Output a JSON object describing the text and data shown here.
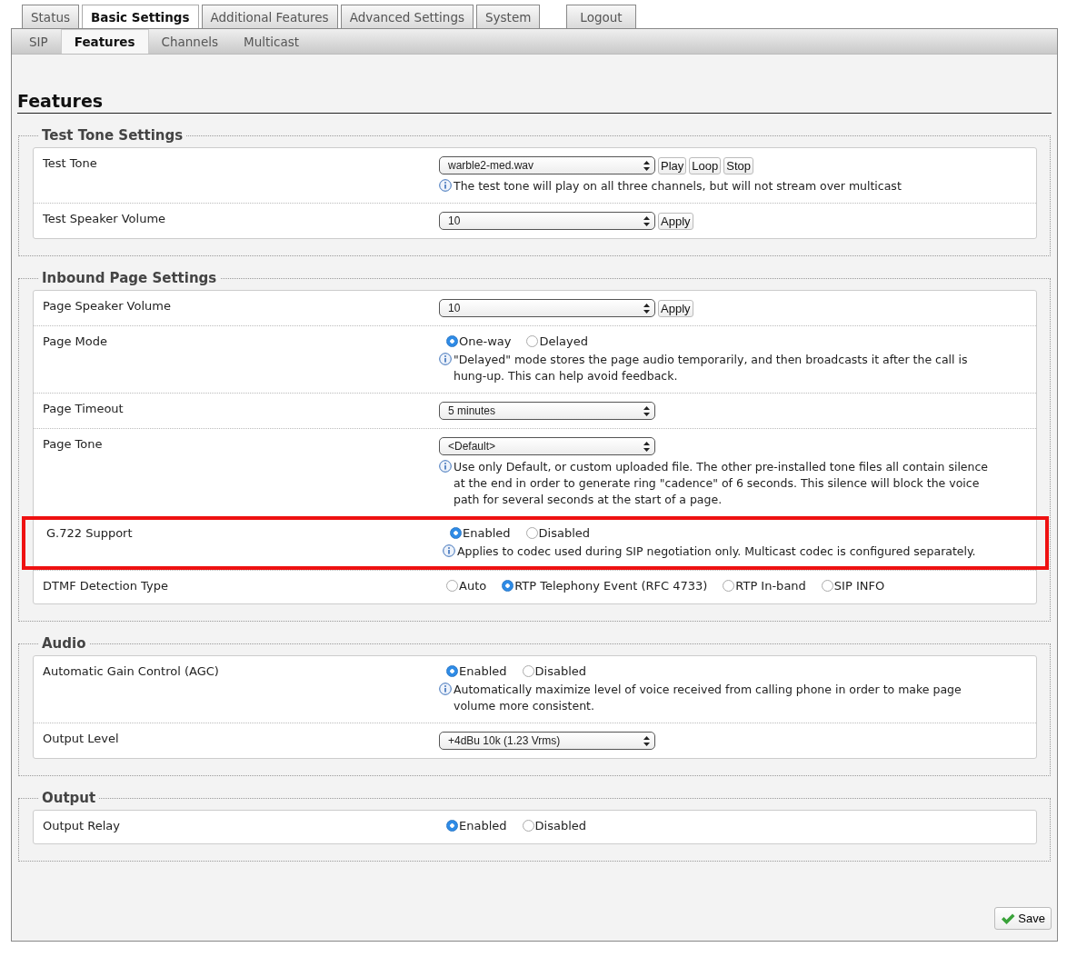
{
  "tabs": [
    {
      "label": "Status",
      "selected": false
    },
    {
      "label": "Basic Settings",
      "selected": true
    },
    {
      "label": "Additional Features",
      "selected": false
    },
    {
      "label": "Advanced Settings",
      "selected": false
    },
    {
      "label": "System",
      "selected": false
    },
    {
      "label": "Logout",
      "selected": false
    }
  ],
  "subtabs": [
    {
      "label": "SIP",
      "selected": false
    },
    {
      "label": "Features",
      "selected": true
    },
    {
      "label": "Channels",
      "selected": false
    },
    {
      "label": "Multicast",
      "selected": false
    }
  ],
  "page_title": "Features",
  "sections": [
    {
      "title": "Test Tone Settings",
      "rows": [
        {
          "label": "Test Tone",
          "highlighted": false,
          "control": {
            "kind": "select",
            "value": "warble2-med.wav",
            "buttons": [
              "Play",
              "Loop",
              "Stop"
            ]
          },
          "note": "The test tone will play on all three channels, but will not stream over multicast"
        },
        {
          "label": "Test Speaker Volume",
          "highlighted": false,
          "control": {
            "kind": "select",
            "value": "10",
            "buttons": [
              "Apply"
            ]
          }
        }
      ]
    },
    {
      "title": "Inbound Page Settings",
      "rows": [
        {
          "label": "Page Speaker Volume",
          "highlighted": false,
          "control": {
            "kind": "select",
            "value": "10",
            "buttons": [
              "Apply"
            ]
          }
        },
        {
          "label": "Page Mode",
          "highlighted": false,
          "control": {
            "kind": "radio",
            "options": [
              {
                "label": "One-way",
                "selected": true
              },
              {
                "label": "Delayed",
                "selected": false
              }
            ]
          },
          "note": "\"Delayed\" mode stores the page audio temporarily, and then broadcasts it after the call is hung-up. This can help avoid feedback."
        },
        {
          "label": "Page Timeout",
          "highlighted": false,
          "control": {
            "kind": "select",
            "value": "5 minutes"
          }
        },
        {
          "label": "Page Tone",
          "highlighted": false,
          "control": {
            "kind": "select",
            "value": "<Default>"
          },
          "note": "Use only Default, or custom uploaded file. The other pre-installed tone files all contain silence at the end in order to generate ring \"cadence\" of 6 seconds. This silence will block the voice path for several seconds at the start of a page."
        },
        {
          "label": "G.722 Support",
          "highlighted": true,
          "control": {
            "kind": "radio",
            "options": [
              {
                "label": "Enabled",
                "selected": true
              },
              {
                "label": "Disabled",
                "selected": false
              }
            ]
          },
          "note": "Applies to codec used during SIP negotiation only. Multicast codec is configured separately."
        },
        {
          "label": "DTMF Detection Type",
          "highlighted": false,
          "control": {
            "kind": "radio",
            "options": [
              {
                "label": "Auto",
                "selected": false
              },
              {
                "label": "RTP Telephony Event (RFC 4733)",
                "selected": true
              },
              {
                "label": "RTP In-band",
                "selected": false
              },
              {
                "label": "SIP INFO",
                "selected": false
              }
            ]
          }
        }
      ]
    },
    {
      "title": "Audio",
      "rows": [
        {
          "label": "Automatic Gain Control (AGC)",
          "highlighted": false,
          "control": {
            "kind": "radio",
            "options": [
              {
                "label": "Enabled",
                "selected": true
              },
              {
                "label": "Disabled",
                "selected": false
              }
            ]
          },
          "note": "Automatically maximize level of voice received from calling phone in order to make page volume more consistent."
        },
        {
          "label": "Output Level",
          "highlighted": false,
          "control": {
            "kind": "select",
            "value": "+4dBu 10k (1.23 Vrms)"
          }
        }
      ]
    },
    {
      "title": "Output",
      "rows": [
        {
          "label": "Output Relay",
          "highlighted": false,
          "control": {
            "kind": "radio",
            "options": [
              {
                "label": "Enabled",
                "selected": true
              },
              {
                "label": "Disabled",
                "selected": false
              }
            ]
          }
        }
      ]
    }
  ],
  "save_button": "Save"
}
